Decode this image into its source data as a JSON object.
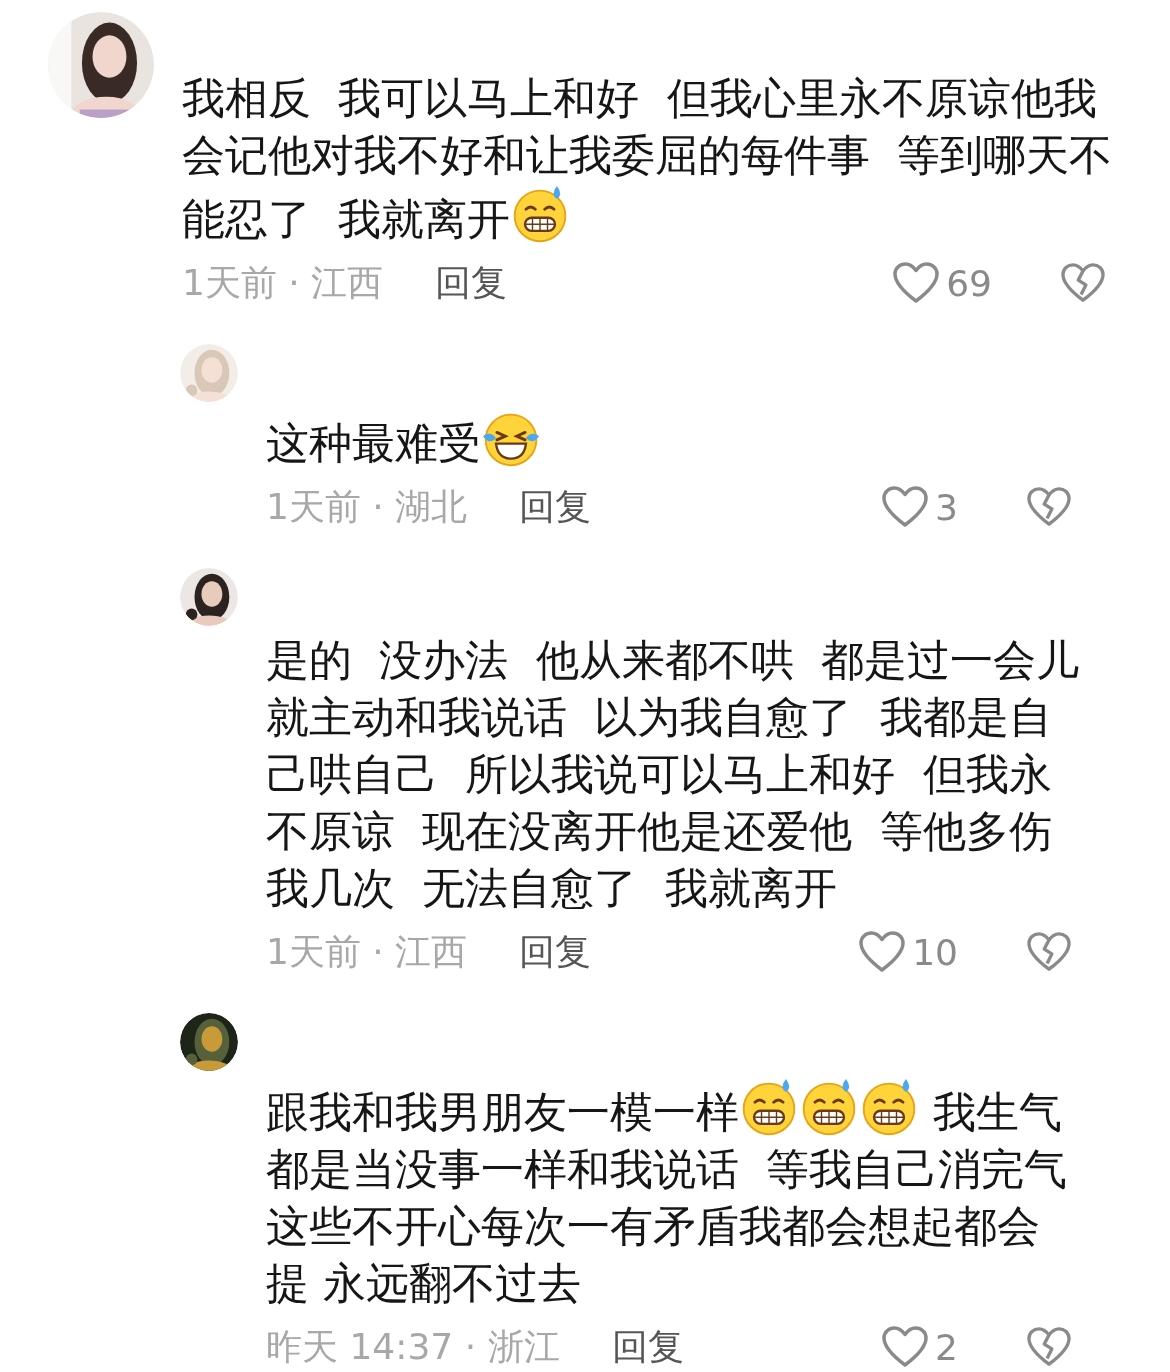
{
  "comments": [
    {
      "body": [
        {
          "kind": "text",
          "text": "我相反  我可以马上和好  但我心里永不原谅他我会记他对我不好和让我委屈的每件事  等到哪天不能忍了  我就离开"
        },
        {
          "kind": "grin"
        }
      ],
      "meta": "1天前 · 江西",
      "reply": "回复",
      "likes": "69",
      "children": [
        {
          "body": [
            {
              "kind": "text",
              "text": "这种最难受"
            },
            {
              "kind": "laugh"
            }
          ],
          "meta": "1天前 · 湖北",
          "reply": "回复",
          "likes": "3"
        },
        {
          "body": [
            {
              "kind": "text",
              "text": "是的  没办法  他从来都不哄  都是过一会儿就主动和我说话  以为我自愈了  我都是自己哄自己  所以我说可以马上和好  但我永不原谅  现在没离开他是还爱他  等他多伤我几次  无法自愈了  我就离开"
            }
          ],
          "meta": "1天前 · 江西",
          "reply": "回复",
          "likes": "10"
        },
        {
          "body": [
            {
              "kind": "text",
              "text": "跟我和我男朋友一模一样"
            },
            {
              "kind": "grin"
            },
            {
              "kind": "grin"
            },
            {
              "kind": "grin"
            },
            {
              "kind": "text",
              "text": " 我生气都是当没事一样和我说话  等我自己消完气这些不开心每次一有矛盾我都会想起都会提 永远翻不过去"
            }
          ],
          "meta": "昨天 14:37 · 浙江",
          "reply": "回复",
          "likes": "2"
        }
      ]
    }
  ]
}
